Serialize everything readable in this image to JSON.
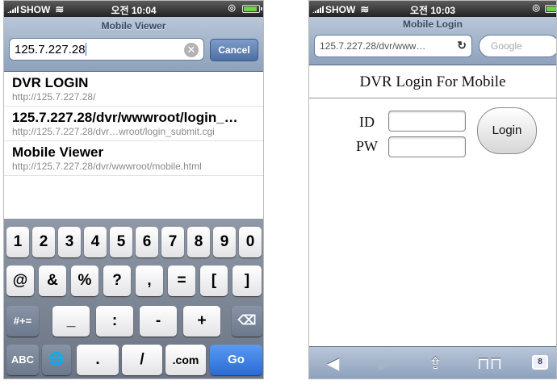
{
  "left": {
    "status": {
      "carrier": "SHOW",
      "time": "오전 10:04"
    },
    "toolbar": {
      "title": "Mobile Viewer",
      "url_value": "125.7.227.28",
      "cancel_label": "Cancel"
    },
    "suggestions": [
      {
        "title": "DVR LOGIN",
        "url": "http://125.7.227.28/"
      },
      {
        "title": "125.7.227.28/dvr/wwwroot/login_…",
        "url": "http://125.7.227.28/dvr…wroot/login_submit.cgi"
      },
      {
        "title": "Mobile Viewer",
        "url": "http://125.7.227.28/dvr/wwwroot/mobile.html"
      }
    ],
    "keyboard": {
      "row1": [
        "1",
        "2",
        "3",
        "4",
        "5",
        "6",
        "7",
        "8",
        "9",
        "0"
      ],
      "row2": [
        "@",
        "&",
        "%",
        "?",
        ",",
        "=",
        "[",
        "]"
      ],
      "row3": [
        "#+=",
        "_",
        ":",
        "-",
        "+",
        "⌫"
      ],
      "row4": [
        "ABC",
        "🌐",
        ".",
        "/",
        ".com",
        "Go"
      ]
    }
  },
  "right": {
    "status": {
      "carrier": "SHOW",
      "time": "오전 10:03"
    },
    "toolbar": {
      "title": "Mobile Login",
      "address": "125.7.227.28/dvr/www…",
      "search_placeholder": "Google"
    },
    "page": {
      "heading": "DVR Login For Mobile",
      "id_label": "ID",
      "pw_label": "PW",
      "login_label": "Login"
    },
    "bottombar": {
      "tab_count": "8"
    }
  },
  "colors": {
    "toolbar": "#9aaec8",
    "keyboard": "#7a8494",
    "go_button": "#2a6bd6"
  }
}
